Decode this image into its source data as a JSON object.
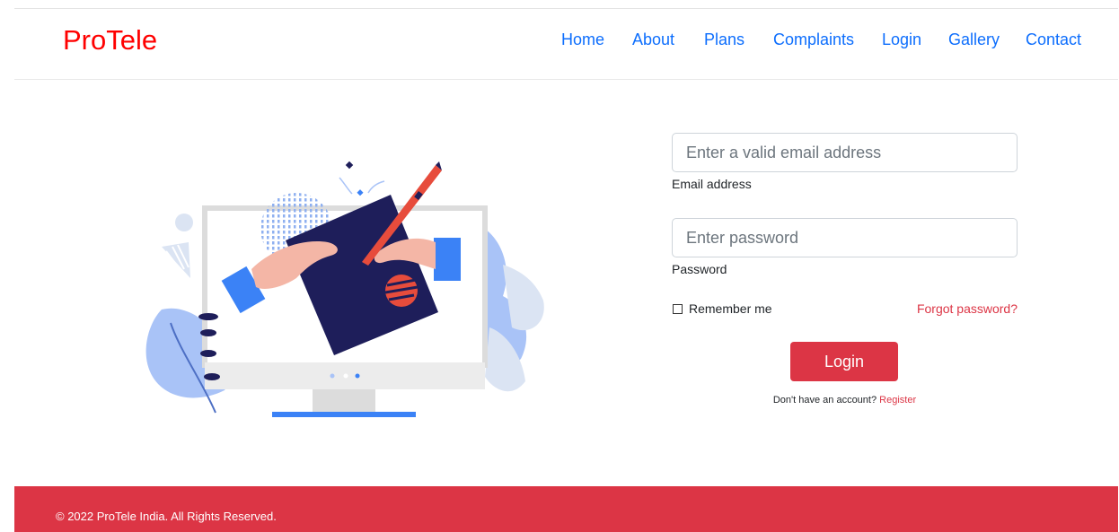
{
  "brand": {
    "name": "ProTele",
    "color": "#ff0000"
  },
  "nav": {
    "items": [
      {
        "label": "Home",
        "name": "nav-home"
      },
      {
        "label": "About",
        "name": "nav-about"
      },
      {
        "label": "Plans",
        "name": "nav-plans"
      },
      {
        "label": "Complaints",
        "name": "nav-complaints"
      },
      {
        "label": "Login",
        "name": "nav-login"
      },
      {
        "label": "Gallery",
        "name": "nav-gallery"
      },
      {
        "label": "Contact",
        "name": "nav-contact"
      }
    ],
    "link_color": "#0d6efd"
  },
  "form": {
    "email": {
      "placeholder": "Enter a valid email address",
      "label": "Email address",
      "value": ""
    },
    "password": {
      "placeholder": "Enter password",
      "label": "Password",
      "value": ""
    },
    "remember_label": "Remember me",
    "forgot_label": "Forgot password?",
    "login_label": "Login",
    "signup_prompt": "Don't have an account?",
    "register_label": "Register"
  },
  "footer": {
    "text": "© 2022 ProTele India. All Rights Reserved.",
    "color": "#dc3545"
  },
  "illustration": {
    "subject": "hands signing a document on a desktop monitor"
  }
}
